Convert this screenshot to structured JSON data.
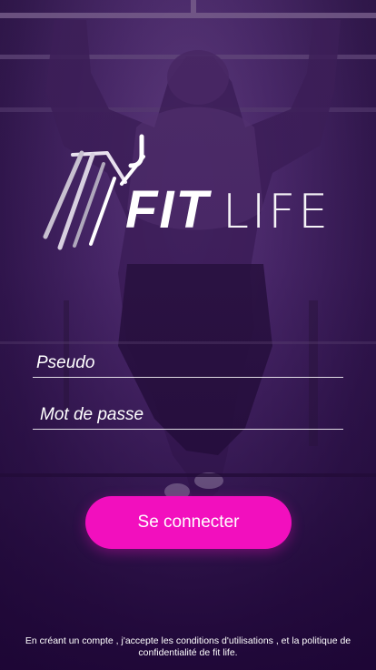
{
  "brand": {
    "fit": "FIT",
    "life": "LIFE"
  },
  "form": {
    "pseudo_placeholder": "Pseudo",
    "password_placeholder": "Mot de passe",
    "submit_label": "Se connecter"
  },
  "footer": {
    "terms_text": "En créant un compte , j'accepte les conditions d'utilisations , et la politique de confidentialité de fit life."
  },
  "colors": {
    "accent": "#f20fbe",
    "overlay": "#4a2d66"
  }
}
